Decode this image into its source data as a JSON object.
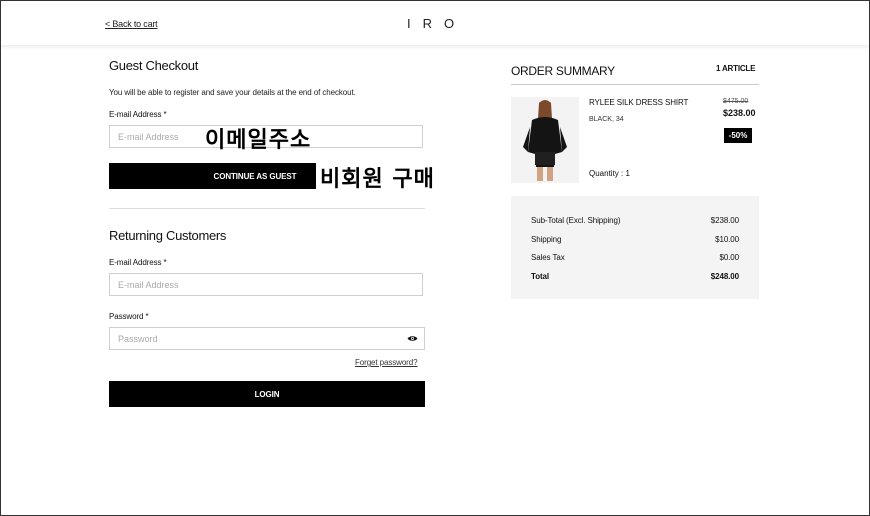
{
  "header": {
    "back_link": "< Back to cart",
    "logo": "IRO"
  },
  "guest": {
    "title": "Guest Checkout",
    "description": "You will be able to register and save your details at the end of checkout.",
    "email_label": "E-mail Address *",
    "email_placeholder": "E-mail Address",
    "email_annotation": "이메일주소",
    "continue_label": "CONTINUE AS GUEST",
    "continue_annotation": "비회원 구매"
  },
  "returning": {
    "title": "Returning Customers",
    "email_label": "E-mail Address *",
    "email_placeholder": "E-mail Address",
    "password_label": "Password *",
    "password_placeholder": "Password",
    "forgot_link": "Forget password?",
    "login_label": "LOGIN"
  },
  "order": {
    "title": "ORDER SUMMARY",
    "article_count": "1 ARTICLE",
    "product": {
      "name": "RYLEE SILK DRESS SHIRT",
      "variant": "BLACK, 34",
      "old_price": "$475.00",
      "new_price": "$238.00",
      "discount": "-50%",
      "quantity": "Quantity : 1"
    },
    "totals": [
      {
        "label": "Sub-Total (Excl. Shipping)",
        "value": "$238.00"
      },
      {
        "label": "Shipping",
        "value": "$10.00"
      },
      {
        "label": "Sales Tax",
        "value": "$0.00"
      },
      {
        "label": "Total",
        "value": "$248.00"
      }
    ]
  },
  "icons": {
    "eye": "eye-icon"
  }
}
